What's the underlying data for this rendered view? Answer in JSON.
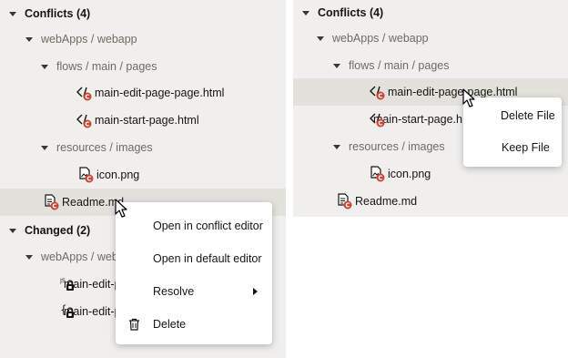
{
  "left": {
    "conflicts_title": "Conflicts (4)",
    "conflict_repo": "webApps / webapp",
    "flows_path": "flows / main / pages",
    "file_edit": "main-edit-page-page.html",
    "file_start": "main-start-page.html",
    "resources_path": "resources / images",
    "file_icon": "icon.png",
    "file_readme": "Readme.md",
    "changed_title": "Changed (2)",
    "changed_repo": "webApps / webapp",
    "changed_file_1": "main-edit-page-page.js",
    "changed_file_2": "main-edit-page-page.json",
    "menu": {
      "open_conflict": "Open in conflict editor",
      "open_default": "Open in default editor",
      "resolve": "Resolve",
      "delete": "Delete"
    }
  },
  "right": {
    "conflicts_title": "Conflicts (4)",
    "conflict_repo": "webApps / webapp",
    "flows_path": "flows / main / pages",
    "file_edit": "main-edit-page-page.html",
    "file_start": "main-start-page.html",
    "resources_path": "resources / images",
    "file_icon": "icon.png",
    "file_readme": "Readme.md",
    "menu": {
      "delete_file": "Delete File",
      "keep_file": "Keep File"
    }
  },
  "colors": {
    "panel_bg": "#f1efed",
    "selected_bg": "#e4e1dd",
    "conflict_badge": "#c74634"
  },
  "icons": [
    "caret-down-icon",
    "html-file-icon",
    "image-file-icon",
    "doc-file-icon",
    "js-file-icon",
    "json-file-icon",
    "conflict-badge-icon",
    "lock-badge-icon",
    "trash-icon",
    "chevron-right-icon",
    "mouse-cursor-icon"
  ]
}
